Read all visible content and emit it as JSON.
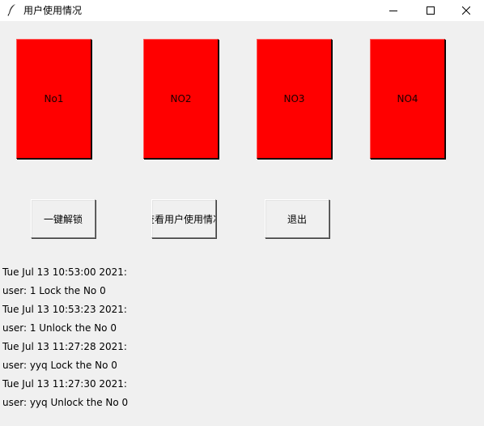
{
  "window": {
    "title": "用户使用情况",
    "icon": "feather-icon",
    "controls": [
      "minimize-icon",
      "maximize-icon",
      "close-icon"
    ]
  },
  "boxes": [
    {
      "label": "No1",
      "color": "#ff0000"
    },
    {
      "label": "NO2",
      "color": "#ff0000"
    },
    {
      "label": "NO3",
      "color": "#ff0000"
    },
    {
      "label": "NO4",
      "color": "#ff0000"
    }
  ],
  "buttons": {
    "unlock_all": "一键解锁",
    "view_usage": "查看用户使用情况",
    "exit": "退出"
  },
  "log": [
    "Tue Jul 13 10:53:00 2021:",
    "user: 1 Lock the No 0",
    "Tue Jul 13 10:53:23 2021:",
    "user: 1 Unlock the No 0",
    "Tue Jul 13 11:27:28 2021:",
    "user: yyq Lock the No 0",
    "Tue Jul 13 11:27:30 2021:",
    "user: yyq Unlock the No 0"
  ]
}
